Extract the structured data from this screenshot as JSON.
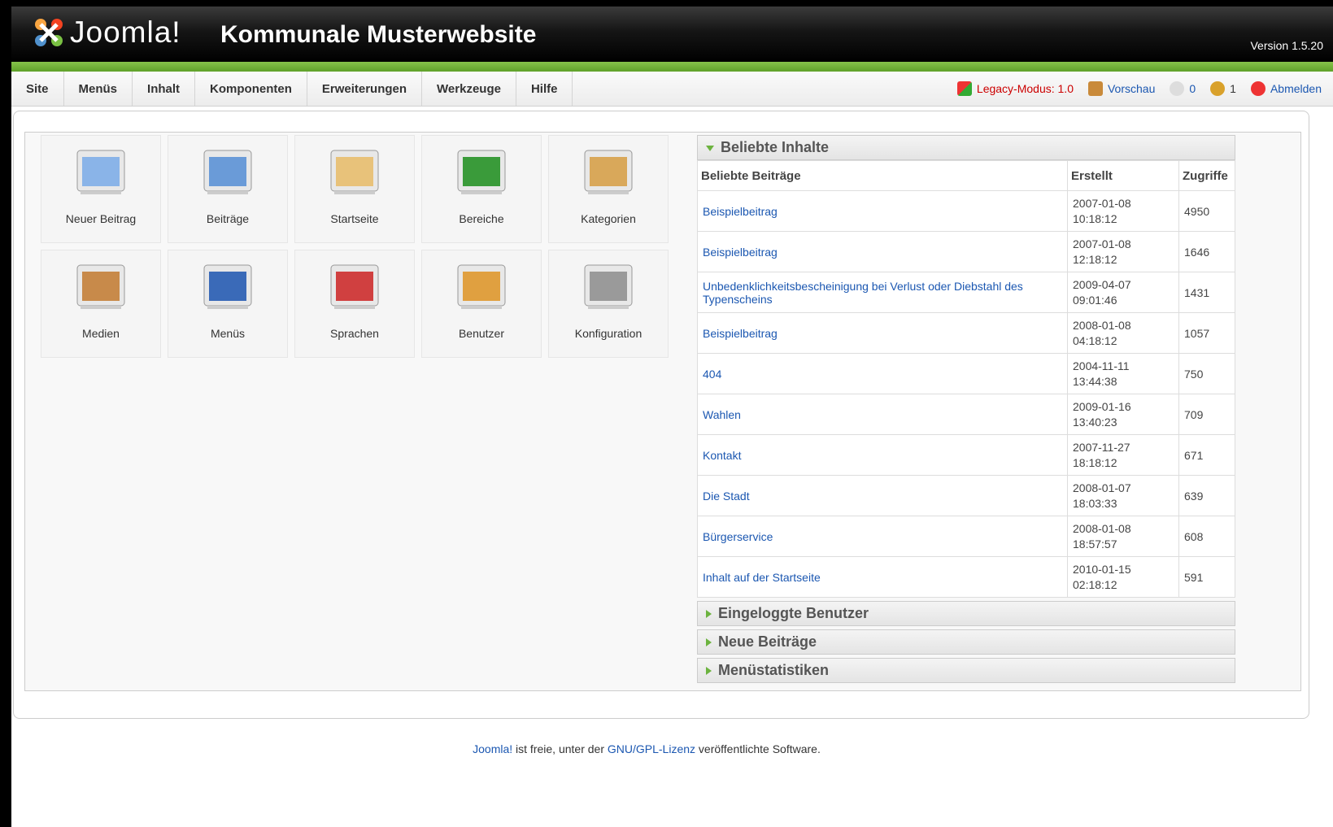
{
  "header": {
    "logo_text": "Joomla!",
    "site_title": "Kommunale Musterwebsite",
    "version": "Version 1.5.20"
  },
  "menu": [
    "Site",
    "Menüs",
    "Inhalt",
    "Komponenten",
    "Erweiterungen",
    "Werkzeuge",
    "Hilfe"
  ],
  "status": {
    "legacy": "Legacy-Modus: 1.0",
    "preview": "Vorschau",
    "messages": "0",
    "users": "1",
    "logout": "Abmelden"
  },
  "quickicons": [
    {
      "label": "Neuer Beitrag",
      "icon": "new-article-icon"
    },
    {
      "label": "Beiträge",
      "icon": "articles-icon"
    },
    {
      "label": "Startseite",
      "icon": "frontpage-icon"
    },
    {
      "label": "Bereiche",
      "icon": "sections-icon"
    },
    {
      "label": "Kategorien",
      "icon": "categories-icon"
    },
    {
      "label": "Medien",
      "icon": "media-icon"
    },
    {
      "label": "Menüs",
      "icon": "menus-icon"
    },
    {
      "label": "Sprachen",
      "icon": "languages-icon"
    },
    {
      "label": "Benutzer",
      "icon": "users-icon"
    },
    {
      "label": "Konfiguration",
      "icon": "config-icon"
    }
  ],
  "popular": {
    "title": "Beliebte Inhalte",
    "headers": [
      "Beliebte Beiträge",
      "Erstellt",
      "Zugriffe"
    ],
    "rows": [
      {
        "title": "Beispielbeitrag",
        "date": "2007-01-08",
        "time": "10:18:12",
        "hits": "4950"
      },
      {
        "title": "Beispielbeitrag",
        "date": "2007-01-08",
        "time": "12:18:12",
        "hits": "1646"
      },
      {
        "title": "Unbedenklichkeitsbescheinigung bei Verlust oder Diebstahl des Typenscheins",
        "date": "2009-04-07",
        "time": "09:01:46",
        "hits": "1431"
      },
      {
        "title": "Beispielbeitrag",
        "date": "2008-01-08",
        "time": "04:18:12",
        "hits": "1057"
      },
      {
        "title": "404",
        "date": "2004-11-11",
        "time": "13:44:38",
        "hits": "750"
      },
      {
        "title": "Wahlen",
        "date": "2009-01-16",
        "time": "13:40:23",
        "hits": "709"
      },
      {
        "title": "Kontakt",
        "date": "2007-11-27",
        "time": "18:18:12",
        "hits": "671"
      },
      {
        "title": "Die Stadt",
        "date": "2008-01-07",
        "time": "18:03:33",
        "hits": "639"
      },
      {
        "title": "Bürgerservice",
        "date": "2008-01-08",
        "time": "18:57:57",
        "hits": "608"
      },
      {
        "title": "Inhalt auf der Startseite",
        "date": "2010-01-15",
        "time": "02:18:12",
        "hits": "591"
      }
    ]
  },
  "collapsed_panels": [
    "Eingeloggte Benutzer",
    "Neue Beiträge",
    "Menüstatistiken"
  ],
  "footer": {
    "joomla_link": "Joomla!",
    "text1": " ist freie, unter der ",
    "license_link": "GNU/GPL-Lizenz",
    "text2": " veröffentlichte Software."
  }
}
